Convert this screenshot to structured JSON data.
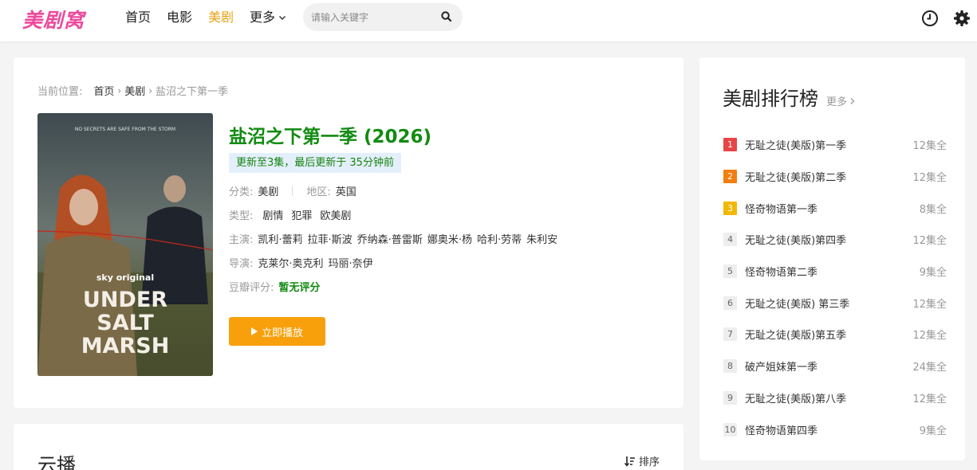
{
  "header": {
    "logo": "美剧窝",
    "nav": [
      {
        "label": "首页",
        "active": false
      },
      {
        "label": "电影",
        "active": false
      },
      {
        "label": "美剧",
        "active": true
      },
      {
        "label": "更多",
        "active": false
      }
    ],
    "search": {
      "placeholder": "请输入关键字",
      "value": ""
    },
    "icons": [
      "clock-icon",
      "gear-icon"
    ]
  },
  "breadcrumb": {
    "label": "当前位置:",
    "items": [
      "首页",
      "美剧",
      "盐沼之下第一季"
    ]
  },
  "show": {
    "title": "盐沼之下第一季 (2026)",
    "update": "更新至3集，最后更新于 35分钟前",
    "category_label": "分类:",
    "category": "美剧",
    "region_label": "地区:",
    "region": "英国",
    "genre_label": "类型:",
    "genres": [
      "剧情",
      "犯罪",
      "欧美剧"
    ],
    "cast_label": "主演:",
    "cast": [
      "凯利·蕾莉",
      "拉菲·斯波",
      "乔纳森·普雷斯",
      "娜奥米·杨",
      "哈利·劳蒂",
      "朱利安"
    ],
    "director_label": "导演:",
    "directors": [
      "克莱尔·奥克利",
      "玛丽·奈伊"
    ],
    "rating_label": "豆瓣评分:",
    "rating": "暂无评分",
    "play_label": "立即播放",
    "poster": {
      "tagline": "NO SECRETS ARE SAFE FROM THE STORM",
      "brand": "sky original",
      "line1": "UNDER",
      "line2": "SALT",
      "line3": "MARSH"
    }
  },
  "player_section": {
    "title": "云播",
    "sort_label": "排序"
  },
  "ranking": {
    "title": "美剧排行榜",
    "more": "更多",
    "items": [
      {
        "rank": "1",
        "name": "无耻之徒(美版)第一季",
        "episodes": "12集全"
      },
      {
        "rank": "2",
        "name": "无耻之徒(美版)第二季",
        "episodes": "12集全"
      },
      {
        "rank": "3",
        "name": "怪奇物语第一季",
        "episodes": "8集全"
      },
      {
        "rank": "4",
        "name": "无耻之徒(美版)第四季",
        "episodes": "12集全"
      },
      {
        "rank": "5",
        "name": "怪奇物语第二季",
        "episodes": "9集全"
      },
      {
        "rank": "6",
        "name": "无耻之徒(美版) 第三季",
        "episodes": "12集全"
      },
      {
        "rank": "7",
        "name": "无耻之徒(美版)第五季",
        "episodes": "12集全"
      },
      {
        "rank": "8",
        "name": "破产姐妹第一季",
        "episodes": "24集全"
      },
      {
        "rank": "9",
        "name": "无耻之徒(美版)第八季",
        "episodes": "12集全"
      },
      {
        "rank": "10",
        "name": "怪奇物语第四季",
        "episodes": "9集全"
      }
    ]
  },
  "colors": {
    "logo": "#ec4a9c",
    "nav_active": "#e8a317",
    "title_green": "#118b11",
    "play_button": "#f7a00b",
    "rank_1": "#e84545",
    "rank_2": "#f27d10",
    "rank_3": "#f2b705"
  }
}
